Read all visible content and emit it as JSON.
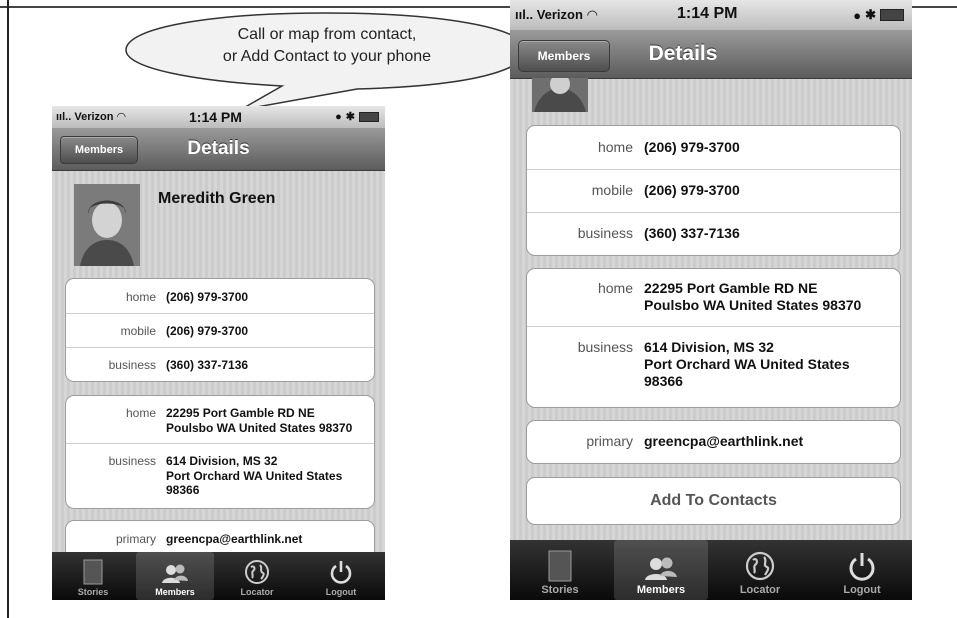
{
  "callout": {
    "line1": "Call or map from contact,",
    "line2": "or Add Contact to your phone"
  },
  "status": {
    "carrier": "Verizon",
    "time": "1:14 PM"
  },
  "nav": {
    "back_label": "Members",
    "title": "Details"
  },
  "contact": {
    "name": "Meredith Green",
    "phones": [
      {
        "label": "home",
        "value": "(206) 979-3700"
      },
      {
        "label": "mobile",
        "value": "(206) 979-3700"
      },
      {
        "label": "business",
        "value": "(360) 337-7136"
      }
    ],
    "addresses": [
      {
        "label": "home",
        "line1": "22295 Port Gamble RD NE",
        "line2": "Poulsbo WA United States 98370",
        "line3": ""
      },
      {
        "label": "business",
        "line1": "614 Division, MS 32",
        "line2": "Port Orchard WA United States",
        "line3": "98366"
      }
    ],
    "emails": [
      {
        "label": "primary",
        "value": "greencpa@earthlink.net"
      }
    ],
    "add_button": "Add To Contacts"
  },
  "tabs": [
    {
      "label": "Stories",
      "icon": "book-icon"
    },
    {
      "label": "Members",
      "icon": "people-icon",
      "selected": true
    },
    {
      "label": "Locator",
      "icon": "globe-icon"
    },
    {
      "label": "Logout",
      "icon": "power-icon"
    }
  ]
}
